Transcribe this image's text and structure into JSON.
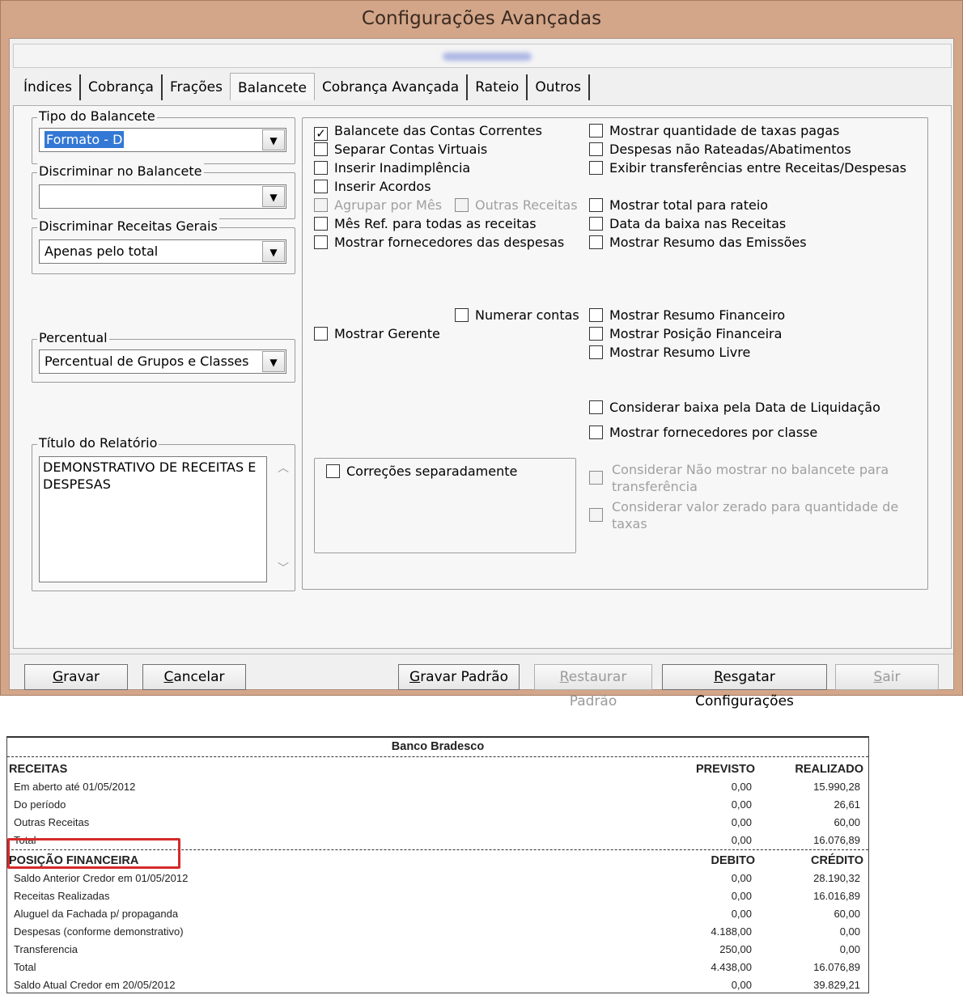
{
  "window": {
    "title": "Configurações Avançadas"
  },
  "tabs": [
    "Índices",
    "Cobrança",
    "Frações",
    "Balancete",
    "Cobrança Avançada",
    "Rateio",
    "Outros"
  ],
  "left": {
    "tipo_legend": "Tipo do Balancete",
    "tipo_value": "Formato - D",
    "discriminar_legend": "Discriminar no Balancete",
    "discriminar_value": "",
    "receitas_legend": "Discriminar Receitas Gerais",
    "receitas_value": "Apenas pelo total",
    "percentual_legend": "Percentual",
    "percentual_value": "Percentual de Grupos e Classes",
    "titulo_legend": "Título do Relatório",
    "titulo_value": "DEMONSTRATIVO DE RECEITAS E DESPESAS"
  },
  "checks": {
    "balancete_contas": "Balancete das Contas Correntes",
    "separar_contas": "Separar Contas Virtuais",
    "inserir_inadimplencia": "Inserir Inadimplência",
    "inserir_acordos": "Inserir Acordos",
    "agrupar_mes": "Agrupar por Mês",
    "outras_receitas": "Outras Receitas",
    "mes_ref": "Mês Ref. para todas as receitas",
    "mostrar_fornecedores_despesas": "Mostrar fornecedores das despesas",
    "numerar_contas": "Numerar contas",
    "mostrar_gerente": "Mostrar Gerente",
    "correcoes": "Correções separadamente",
    "mostrar_qtd_taxas": "Mostrar quantidade de taxas pagas",
    "despesas_nao_rateadas": "Despesas não Rateadas/Abatimentos",
    "exibir_transferencias": "Exibir transferências entre Receitas/Despesas",
    "mostrar_total_rateio": "Mostrar total para rateio",
    "data_baixa": "Data da baixa nas Receitas",
    "resumo_emissoes": "Mostrar Resumo das Emissões",
    "resumo_financeiro": "Mostrar Resumo Financeiro",
    "posicao_financeira": "Mostrar Posição Financeira",
    "resumo_livre": "Mostrar Resumo Livre",
    "baixa_liquidacao": "Considerar baixa pela Data de Liquidação",
    "fornecedores_classe": "Mostrar fornecedores por classe",
    "nao_mostrar_transferencia": "Considerar Não mostrar no balancete para transferência",
    "valor_zerado": "Considerar valor zerado para quantidade de taxas"
  },
  "buttons": {
    "gravar": "Gravar",
    "cancelar": "Cancelar",
    "gravar_padrao": "Gravar Padrão",
    "restaurar_padrao": "Restaurar Padrão",
    "resgatar": "Resgatar Configurações",
    "sair": "Sair"
  },
  "report": {
    "bank": "Banco Bradesco",
    "receitas_header": "RECEITAS",
    "previsto": "PREVISTO",
    "realizado": "REALIZADO",
    "receitas_rows": [
      {
        "label": "Em aberto até 01/05/2012",
        "a": "0,00",
        "b": "15.990,28"
      },
      {
        "label": "Do período",
        "a": "0,00",
        "b": "26,61"
      },
      {
        "label": "Outras Receitas",
        "a": "0,00",
        "b": "60,00"
      },
      {
        "label": "Total",
        "a": "0,00",
        "b": "16.076,89"
      }
    ],
    "posicao_header": "POSIÇÃO FINANCEIRA",
    "debito": "DEBITO",
    "credito": "CRÉDITO",
    "posicao_rows": [
      {
        "label": "Saldo Anterior Credor em 01/05/2012",
        "a": "0,00",
        "b": "28.190,32"
      },
      {
        "label": "Receitas Realizadas",
        "a": "0,00",
        "b": "16.016,89"
      },
      {
        "label": "Aluguel da Fachada p/ propaganda",
        "a": "0,00",
        "b": "60,00"
      },
      {
        "label": "Despesas (conforme demonstrativo)",
        "a": "4.188,00",
        "b": "0,00"
      },
      {
        "label": "Transferencia",
        "a": "250,00",
        "b": "0,00"
      },
      {
        "label": "Total",
        "a": "4.438,00",
        "b": "16.076,89"
      },
      {
        "label": "Saldo Atual Credor em 20/05/2012",
        "a": "0,00",
        "b": "39.829,21"
      }
    ]
  }
}
